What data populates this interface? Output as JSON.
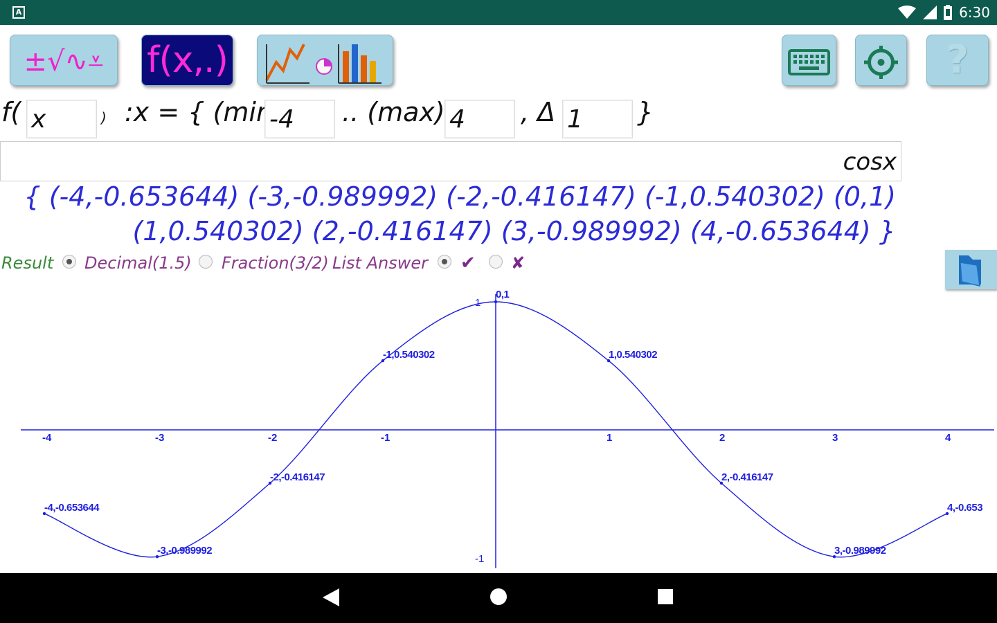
{
  "status_bar": {
    "time": "6:30",
    "icons": [
      "notification-a-icon",
      "wifi-icon",
      "cell-signal-icon",
      "battery-icon"
    ]
  },
  "toolbar": {
    "math_label": "±√∿⩡",
    "fx_label": "f(x,.)",
    "graph_icon": "line-pie-bar-chart-icon",
    "keyboard_icon": "keyboard-icon",
    "settings_icon": "settings-icon",
    "help_label": "?"
  },
  "function_row": {
    "f_open": "f(",
    "var_value": "x",
    "close_paren": ")",
    "range_label": ":x = { (min)",
    "min_value": "-4",
    "max_label": ".. (max)",
    "max_value": "4",
    "step_label": ", Δ",
    "step_value": "1",
    "close_brace": "}"
  },
  "expression": "cosx",
  "result": {
    "line1": "{ (-4,-0.653644) (-3,-0.989992) (-2,-0.416147) (-1,0.540302) (0,1)",
    "line2": "(1,0.540302) (2,-0.416147) (3,-0.989992) (4,-0.653644) }"
  },
  "options": {
    "result_label": "Result",
    "decimal_label": "Decimal(1.5)",
    "fraction_label": "Fraction(3/2)",
    "list_answer_label": "List Answer",
    "check_mark": "✔",
    "cross_mark": "✘",
    "selected": {
      "decimal": true,
      "fraction": false,
      "list_check": true,
      "list_cross": false
    }
  },
  "colors": {
    "status_bar": "#0e5a4e",
    "button": "#a9d4e3",
    "fx_button": "#0a0a7a",
    "magenta": "#ff2bd8",
    "result_blue": "#2b2bd6",
    "plot": "#2020e0",
    "green_label": "#3a8a3a",
    "purple_label": "#8a3a8a"
  },
  "chart_data": {
    "type": "line",
    "xlim": [
      -4,
      4
    ],
    "ylim": [
      -1,
      1
    ],
    "x_ticks": [
      "-4",
      "-3",
      "-2",
      "-1",
      "1",
      "2",
      "3",
      "4"
    ],
    "y_ticks": [
      "1",
      "-1"
    ],
    "points": [
      {
        "x": -4,
        "y": -0.653644,
        "label": "-4,-0.653644"
      },
      {
        "x": -3,
        "y": -0.989992,
        "label": "-3,-0.989992"
      },
      {
        "x": -2,
        "y": -0.416147,
        "label": "-2,-0.416147"
      },
      {
        "x": -1,
        "y": 0.540302,
        "label": "-1,0.540302"
      },
      {
        "x": 0,
        "y": 1,
        "label": "0,1"
      },
      {
        "x": 1,
        "y": 0.540302,
        "label": "1,0.540302"
      },
      {
        "x": 2,
        "y": -0.416147,
        "label": "2,-0.416147"
      },
      {
        "x": 3,
        "y": -0.989992,
        "label": "3,-0.989992"
      },
      {
        "x": 4,
        "y": -0.653644,
        "label": "4,-0.653"
      }
    ]
  }
}
